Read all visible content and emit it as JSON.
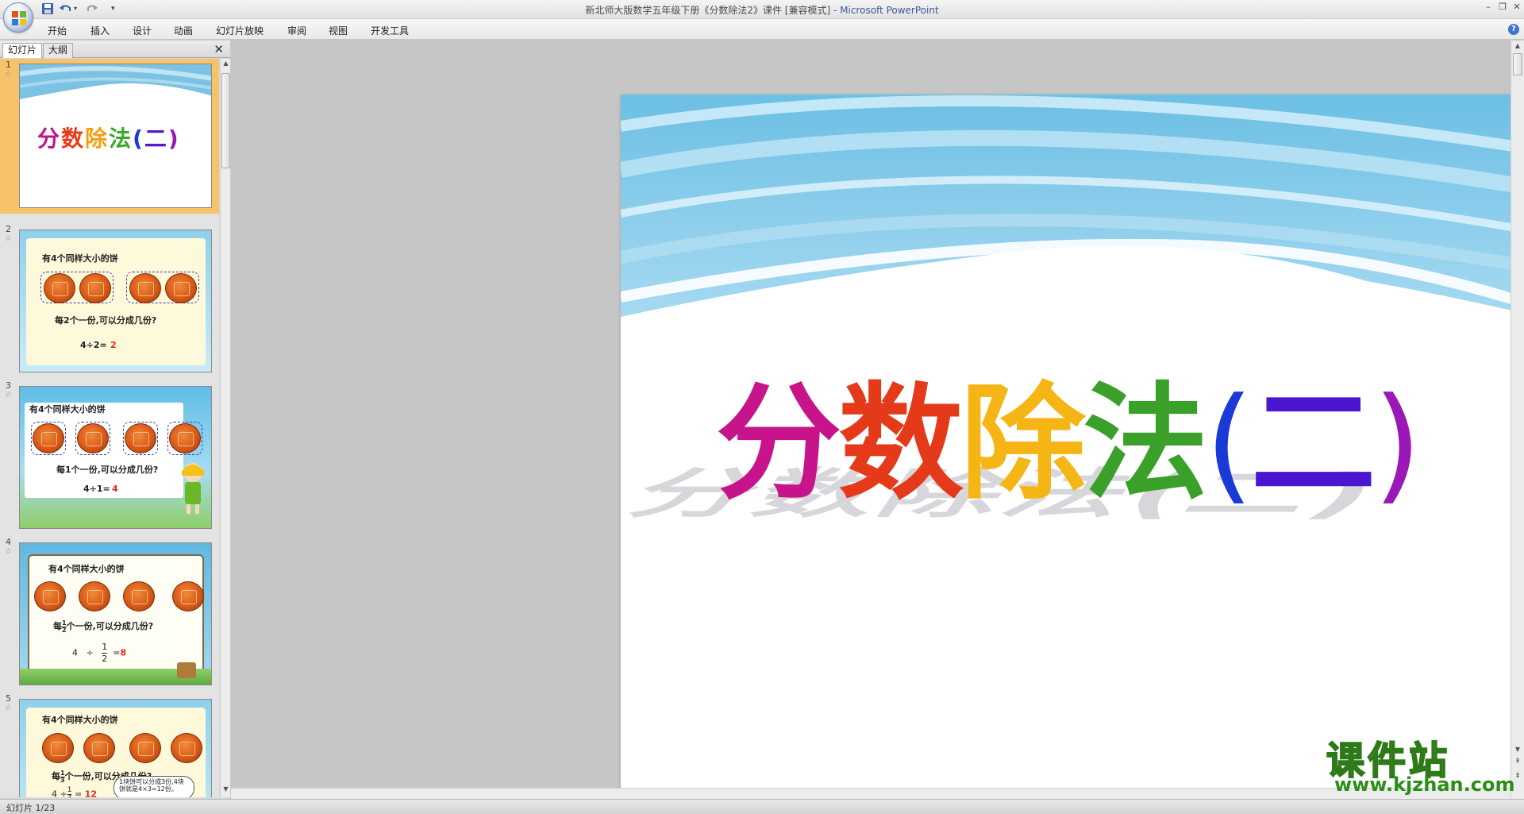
{
  "window": {
    "title": "新北师大版数学五年级下册《分数除法2》课件 [兼容模式] - ",
    "app_name": "Microsoft PowerPoint"
  },
  "ribbon": {
    "tabs": [
      "开始",
      "插入",
      "设计",
      "动画",
      "幻灯片放映",
      "审阅",
      "视图",
      "开发工具"
    ]
  },
  "pane": {
    "tabs": [
      "幻灯片",
      "大纲"
    ],
    "close": "✕"
  },
  "thumbnails": [
    {
      "num": "1",
      "title": "分数除法(二)"
    },
    {
      "num": "2",
      "heading": "有4个同样大小的饼",
      "question": "每2个一份,可以分成几份?",
      "equation": "4÷2=",
      "answer": "2"
    },
    {
      "num": "3",
      "heading": "有4个同样大小的饼",
      "question": "每1个一份,可以分成几份?",
      "equation": "4÷1=",
      "answer": "4"
    },
    {
      "num": "4",
      "heading": "有4个同样大小的饼",
      "question_pre": "每",
      "frac_num": "1",
      "frac_den": "2",
      "question_post": "个一份,可以分成几份?",
      "eq_left": "4",
      "eq_op": "÷",
      "answer": "8"
    },
    {
      "num": "5",
      "heading": "有4个同样大小的饼",
      "question_pre": "每",
      "frac_num": "1",
      "frac_den": "3",
      "question_post": "个一份,可以分成几份?",
      "eq_left": "4 ÷",
      "answer": "12",
      "bubble": "1块饼可以分成3份,4块饼就是4×3=12份。"
    }
  ],
  "slide": {
    "title_chars": [
      "分",
      "数",
      "除",
      "法",
      "(",
      "二",
      ")"
    ]
  },
  "status": {
    "slide_info": "幻灯片 1/23"
  },
  "watermark": {
    "name": "课件站",
    "url": "www.kjzhan.com"
  },
  "colors": {
    "title_gradient": [
      "#c0128a",
      "#e83a1a",
      "#f29a10",
      "#f2d21a",
      "#3aa82a",
      "#1a3ad8",
      "#6a1ac8",
      "#9a18b8"
    ]
  }
}
